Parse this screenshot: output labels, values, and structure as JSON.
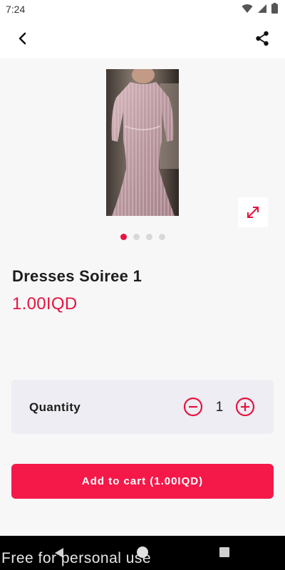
{
  "status_bar": {
    "time": "7:24"
  },
  "header": {
    "back_icon": "chevron-left-icon",
    "share_icon": "share-icon"
  },
  "carousel": {
    "image": "dress-photo",
    "page_count": 4,
    "active_index": 0,
    "expand_icon": "expand-icon"
  },
  "product": {
    "name": "Dresses Soiree 1",
    "price": "1.00IQD"
  },
  "quantity": {
    "label": "Quantity",
    "value": "1"
  },
  "cart": {
    "button_label": "Add to cart (1.00IQD)"
  },
  "watermark": "Free for personal use",
  "colors": {
    "accent": "#e8133f",
    "button": "#f5194a",
    "card_bg": "#ededf3",
    "content_bg": "#f7f7f7"
  }
}
